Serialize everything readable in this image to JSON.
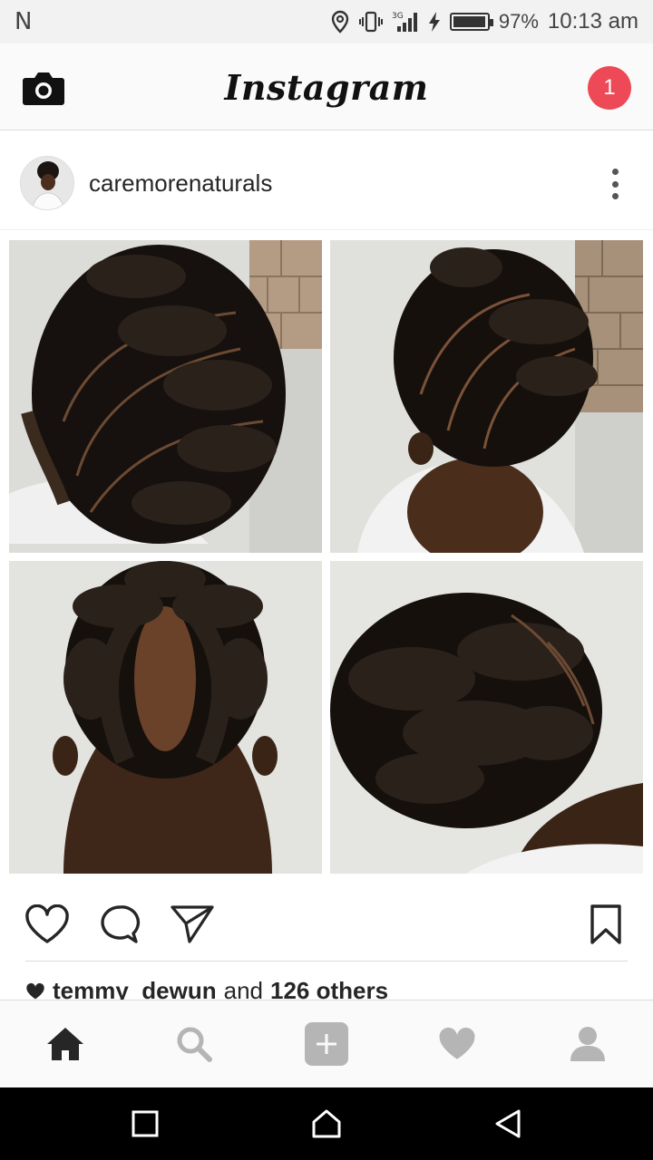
{
  "status_bar": {
    "carrier_glyph": "N",
    "network": "3G",
    "battery": "97%",
    "battery_level": 0.97,
    "time": "10:13 am"
  },
  "header": {
    "logo": "Instagram",
    "camera_icon": "camera-icon",
    "notification_count": "1",
    "badge_color": "#ed4956"
  },
  "post": {
    "username": "caremorenaturals",
    "more_icon": "more-vertical-icon",
    "image_description_icons": [
      "photo-1",
      "photo-2",
      "photo-3",
      "photo-4"
    ],
    "liked_by": "temmy_dewun",
    "likes_connector": "and",
    "likes_others": "126 others"
  },
  "actions": {
    "like": "heart-icon",
    "comment": "comment-icon",
    "share": "send-icon",
    "save": "bookmark-icon"
  },
  "bottom_nav": [
    "home-icon",
    "search-icon",
    "add-icon",
    "activity-heart-icon",
    "profile-icon"
  ],
  "system_nav": [
    "recent-apps-icon",
    "home-icon",
    "back-icon"
  ]
}
